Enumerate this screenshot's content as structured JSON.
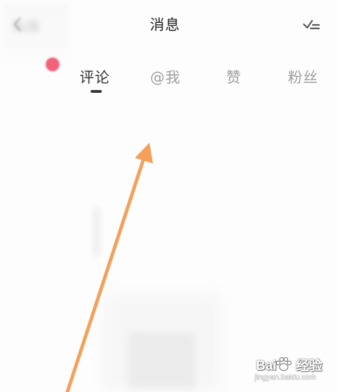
{
  "header": {
    "title": "消息",
    "back_icon": "chevron-left-icon",
    "read_all_icon": "check-list-icon"
  },
  "tabs": {
    "faded_label": "私信",
    "items": [
      {
        "label": "评论",
        "active": true
      },
      {
        "label": "@我",
        "active": false
      },
      {
        "label": "赞",
        "active": false
      },
      {
        "label": "粉丝",
        "active": false
      }
    ]
  },
  "badge": {
    "color": "#f2617a"
  },
  "annotation": {
    "arrow_color": "#f4a05a"
  },
  "watermark": {
    "brand_left": "Bai",
    "brand_right": "经验",
    "url": "jingyan.baidu.com"
  }
}
